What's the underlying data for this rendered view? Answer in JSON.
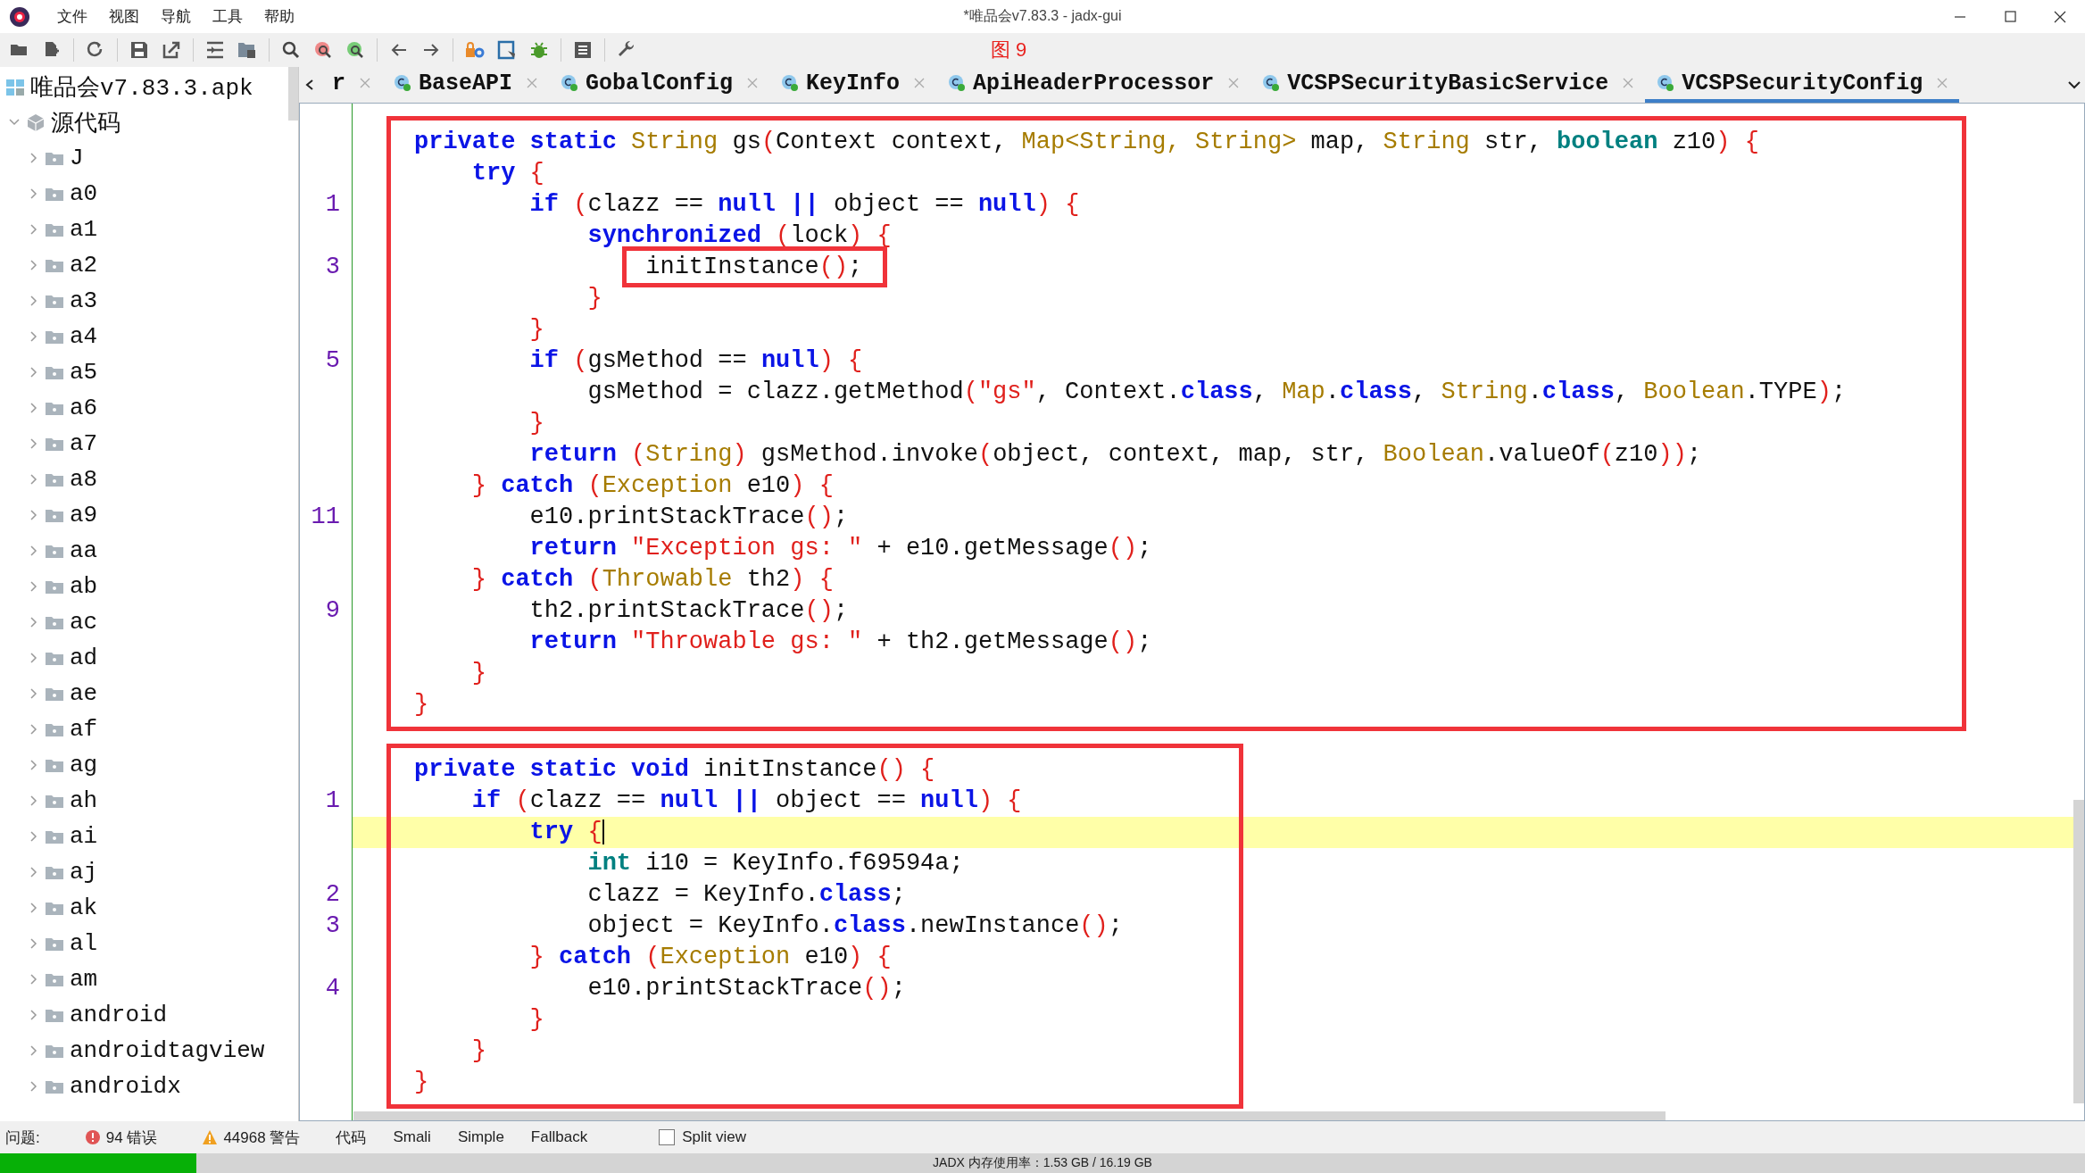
{
  "window": {
    "title": "*唯品会v7.83.3 - jadx-gui"
  },
  "menu": [
    "文件",
    "视图",
    "导航",
    "工具",
    "帮助"
  ],
  "figure_label": "图 9",
  "tree": [
    {
      "label": "唯品会v7.83.3.apk",
      "kind": "apk",
      "children": [
        {
          "label": "源代码",
          "kind": "source",
          "expanded": true,
          "children": [
            {
              "label": "J",
              "kind": "package",
              "expanded": false
            },
            {
              "label": "a0",
              "kind": "package",
              "expanded": false
            },
            {
              "label": "a1",
              "kind": "package",
              "expanded": false
            },
            {
              "label": "a2",
              "kind": "package",
              "expanded": false
            },
            {
              "label": "a3",
              "kind": "package",
              "expanded": false
            },
            {
              "label": "a4",
              "kind": "package",
              "expanded": false
            },
            {
              "label": "a5",
              "kind": "package",
              "expanded": false
            },
            {
              "label": "a6",
              "kind": "package",
              "expanded": false
            },
            {
              "label": "a7",
              "kind": "package",
              "expanded": false
            },
            {
              "label": "a8",
              "kind": "package",
              "expanded": false
            },
            {
              "label": "a9",
              "kind": "package",
              "expanded": false
            },
            {
              "label": "aa",
              "kind": "package",
              "expanded": false
            },
            {
              "label": "ab",
              "kind": "package",
              "expanded": false
            },
            {
              "label": "ac",
              "kind": "package",
              "expanded": false
            },
            {
              "label": "ad",
              "kind": "package",
              "expanded": false
            },
            {
              "label": "ae",
              "kind": "package",
              "expanded": false
            },
            {
              "label": "af",
              "kind": "package",
              "expanded": false
            },
            {
              "label": "ag",
              "kind": "package",
              "expanded": false
            },
            {
              "label": "ah",
              "kind": "package",
              "expanded": false
            },
            {
              "label": "ai",
              "kind": "package",
              "expanded": false
            },
            {
              "label": "aj",
              "kind": "package",
              "expanded": false
            },
            {
              "label": "ak",
              "kind": "package",
              "expanded": false
            },
            {
              "label": "al",
              "kind": "package",
              "expanded": false
            },
            {
              "label": "am",
              "kind": "package",
              "expanded": false
            },
            {
              "label": "android",
              "kind": "package",
              "expanded": false
            },
            {
              "label": "androidtagview",
              "kind": "package",
              "expanded": false
            },
            {
              "label": "androidx",
              "kind": "package",
              "expanded": false
            }
          ]
        }
      ]
    }
  ],
  "tabs": [
    {
      "label": "r",
      "kind": "cut",
      "selected": false
    },
    {
      "label": "BaseAPI",
      "kind": "class",
      "selected": false
    },
    {
      "label": "GobalConfig",
      "kind": "class",
      "selected": false
    },
    {
      "label": "KeyInfo",
      "kind": "class",
      "selected": false
    },
    {
      "label": "ApiHeaderProcessor",
      "kind": "class",
      "selected": false
    },
    {
      "label": "VCSPSecurityBasicService",
      "kind": "class",
      "selected": false
    },
    {
      "label": "VCSPSecurityConfig",
      "kind": "class",
      "selected": true
    }
  ],
  "code": [
    {
      "lines": [
        {
          "tokens": [
            {
              "kind": "kw",
              "text": "private static "
            },
            {
              "kind": "type",
              "text": "String"
            },
            {
              "kind": "plain",
              "text": " gs"
            },
            {
              "kind": "br",
              "text": "("
            },
            {
              "kind": "plain",
              "text": "Context context, "
            },
            {
              "kind": "type",
              "text": "Map<String, String>"
            },
            {
              "kind": "plain",
              "text": " map, "
            },
            {
              "kind": "type",
              "text": "String"
            },
            {
              "kind": "plain",
              "text": " str, "
            },
            {
              "kind": "prim",
              "text": "boolean"
            },
            {
              "kind": "plain",
              "text": " z10"
            },
            {
              "kind": "br",
              "text": ") {"
            }
          ]
        },
        {
          "tokens": [
            {
              "kind": "kw",
              "text": "    try"
            },
            {
              "kind": "br",
              "text": " {"
            }
          ]
        },
        {
          "number": "1",
          "tokens": [
            {
              "kind": "kw",
              "text": "        if"
            },
            {
              "kind": "br",
              "text": " ("
            },
            {
              "kind": "plain",
              "text": "clazz == "
            },
            {
              "kind": "kw",
              "text": "null ||"
            },
            {
              "kind": "plain",
              "text": " object == "
            },
            {
              "kind": "kw",
              "text": "null"
            },
            {
              "kind": "br",
              "text": ") {"
            }
          ]
        },
        {
          "tokens": [
            {
              "kind": "kw",
              "text": "            synchronized"
            },
            {
              "kind": "br",
              "text": " ("
            },
            {
              "kind": "plain",
              "text": "lock"
            },
            {
              "kind": "br",
              "text": ") {"
            }
          ]
        },
        {
          "number": "3",
          "boxed": true,
          "tokens": [
            {
              "kind": "plain",
              "text": "                initInstance"
            },
            {
              "kind": "br",
              "text": "()"
            },
            {
              "kind": "plain",
              "text": ";"
            }
          ]
        },
        {
          "tokens": [
            {
              "kind": "br",
              "text": "            }"
            }
          ]
        },
        {
          "tokens": [
            {
              "kind": "br",
              "text": "        }"
            }
          ]
        },
        {
          "number": "5",
          "tokens": [
            {
              "kind": "kw",
              "text": "        if"
            },
            {
              "kind": "br",
              "text": " ("
            },
            {
              "kind": "plain",
              "text": "gsMethod == "
            },
            {
              "kind": "kw",
              "text": "null"
            },
            {
              "kind": "br",
              "text": ") {"
            }
          ]
        },
        {
          "tokens": [
            {
              "kind": "plain",
              "text": "            gsMethod = clazz.getMethod"
            },
            {
              "kind": "br",
              "text": "("
            },
            {
              "kind": "str",
              "text": "\"gs\""
            },
            {
              "kind": "plain",
              "text": ", Context."
            },
            {
              "kind": "kw",
              "text": "class"
            },
            {
              "kind": "plain",
              "text": ", "
            },
            {
              "kind": "type",
              "text": "Map"
            },
            {
              "kind": "plain",
              "text": "."
            },
            {
              "kind": "kw",
              "text": "class"
            },
            {
              "kind": "plain",
              "text": ", "
            },
            {
              "kind": "type",
              "text": "String"
            },
            {
              "kind": "plain",
              "text": "."
            },
            {
              "kind": "kw",
              "text": "class"
            },
            {
              "kind": "plain",
              "text": ", "
            },
            {
              "kind": "type",
              "text": "Boolean"
            },
            {
              "kind": "plain",
              "text": ".TYPE"
            },
            {
              "kind": "br",
              "text": ")"
            },
            {
              "kind": "plain",
              "text": ";"
            }
          ]
        },
        {
          "tokens": [
            {
              "kind": "br",
              "text": "        }"
            }
          ]
        },
        {
          "tokens": [
            {
              "kind": "kw",
              "text": "        return"
            },
            {
              "kind": "br",
              "text": " ("
            },
            {
              "kind": "type",
              "text": "String"
            },
            {
              "kind": "br",
              "text": ")"
            },
            {
              "kind": "plain",
              "text": " gsMethod.invoke"
            },
            {
              "kind": "br",
              "text": "("
            },
            {
              "kind": "plain",
              "text": "object, context, map, str, "
            },
            {
              "kind": "type",
              "text": "Boolean"
            },
            {
              "kind": "plain",
              "text": ".valueOf"
            },
            {
              "kind": "br",
              "text": "("
            },
            {
              "kind": "plain",
              "text": "z10"
            },
            {
              "kind": "br",
              "text": "))"
            },
            {
              "kind": "plain",
              "text": ";"
            }
          ]
        },
        {
          "tokens": [
            {
              "kind": "br",
              "text": "    } "
            },
            {
              "kind": "kw",
              "text": "catch"
            },
            {
              "kind": "br",
              "text": " ("
            },
            {
              "kind": "type",
              "text": "Exception"
            },
            {
              "kind": "plain",
              "text": " e10"
            },
            {
              "kind": "br",
              "text": ") {"
            }
          ]
        },
        {
          "number": "11",
          "tokens": [
            {
              "kind": "plain",
              "text": "        e10.printStackTrace"
            },
            {
              "kind": "br",
              "text": "()"
            },
            {
              "kind": "plain",
              "text": ";"
            }
          ]
        },
        {
          "tokens": [
            {
              "kind": "kw",
              "text": "        return"
            },
            {
              "kind": "str",
              "text": " \"Exception gs: \""
            },
            {
              "kind": "plain",
              "text": " + e10.getMessage"
            },
            {
              "kind": "br",
              "text": "()"
            },
            {
              "kind": "plain",
              "text": ";"
            }
          ]
        },
        {
          "tokens": [
            {
              "kind": "br",
              "text": "    } "
            },
            {
              "kind": "kw",
              "text": "catch"
            },
            {
              "kind": "br",
              "text": " ("
            },
            {
              "kind": "type",
              "text": "Throwable"
            },
            {
              "kind": "plain",
              "text": " th2"
            },
            {
              "kind": "br",
              "text": ") {"
            }
          ]
        },
        {
          "number": "9",
          "tokens": [
            {
              "kind": "plain",
              "text": "        th2.printStackTrace"
            },
            {
              "kind": "br",
              "text": "()"
            },
            {
              "kind": "plain",
              "text": ";"
            }
          ]
        },
        {
          "tokens": [
            {
              "kind": "kw",
              "text": "        return"
            },
            {
              "kind": "str",
              "text": " \"Throwable gs: \""
            },
            {
              "kind": "plain",
              "text": " + th2.getMessage"
            },
            {
              "kind": "br",
              "text": "()"
            },
            {
              "kind": "plain",
              "text": ";"
            }
          ]
        },
        {
          "tokens": [
            {
              "kind": "br",
              "text": "    }"
            }
          ]
        },
        {
          "tokens": [
            {
              "kind": "br",
              "text": "}"
            }
          ]
        }
      ]
    },
    {
      "lines": [
        {
          "tokens": [
            {
              "kind": "kw",
              "text": "private static void "
            },
            {
              "kind": "plain",
              "text": "initInstance"
            },
            {
              "kind": "br",
              "text": "() {"
            }
          ]
        },
        {
          "number": "1",
          "tokens": [
            {
              "kind": "kw",
              "text": "    if"
            },
            {
              "kind": "br",
              "text": " ("
            },
            {
              "kind": "plain",
              "text": "clazz == "
            },
            {
              "kind": "kw",
              "text": "null ||"
            },
            {
              "kind": "plain",
              "text": " object == "
            },
            {
              "kind": "kw",
              "text": "null"
            },
            {
              "kind": "br",
              "text": ") {"
            }
          ]
        },
        {
          "current": true,
          "tokens": [
            {
              "kind": "kw",
              "text": "        try"
            },
            {
              "kind": "br",
              "text": " {"
            }
          ]
        },
        {
          "tokens": [
            {
              "kind": "prim",
              "text": "            int"
            },
            {
              "kind": "plain",
              "text": " i10 = KeyInfo.f69594a;"
            }
          ]
        },
        {
          "number": "2",
          "tokens": [
            {
              "kind": "plain",
              "text": "            clazz = KeyInfo."
            },
            {
              "kind": "kw",
              "text": "class"
            },
            {
              "kind": "plain",
              "text": ";"
            }
          ]
        },
        {
          "number": "3",
          "tokens": [
            {
              "kind": "plain",
              "text": "            object = KeyInfo."
            },
            {
              "kind": "kw",
              "text": "class"
            },
            {
              "kind": "plain",
              "text": ".newInstance"
            },
            {
              "kind": "br",
              "text": "()"
            },
            {
              "kind": "plain",
              "text": ";"
            }
          ]
        },
        {
          "tokens": [
            {
              "kind": "br",
              "text": "        } "
            },
            {
              "kind": "kw",
              "text": "catch"
            },
            {
              "kind": "br",
              "text": " ("
            },
            {
              "kind": "type",
              "text": "Exception"
            },
            {
              "kind": "plain",
              "text": " e10"
            },
            {
              "kind": "br",
              "text": ") {"
            }
          ]
        },
        {
          "number": "4",
          "tokens": [
            {
              "kind": "plain",
              "text": "            e10.printStackTrace"
            },
            {
              "kind": "br",
              "text": "()"
            },
            {
              "kind": "plain",
              "text": ";"
            }
          ]
        },
        {
          "tokens": [
            {
              "kind": "br",
              "text": "        }"
            }
          ]
        },
        {
          "tokens": [
            {
              "kind": "br",
              "text": "    }"
            }
          ]
        },
        {
          "tokens": [
            {
              "kind": "br",
              "text": "}"
            }
          ]
        }
      ]
    }
  ],
  "issues": {
    "label": "问题:",
    "errors": "94 错误",
    "warnings": "44968 警告"
  },
  "view_tabs": [
    "代码",
    "Smali",
    "Simple",
    "Fallback"
  ],
  "split_view": {
    "label": "Split view",
    "checked": false
  },
  "memory": {
    "level": 0.094,
    "text": "JADX 内存使用率：1.53 GB / 16.19 GB"
  }
}
